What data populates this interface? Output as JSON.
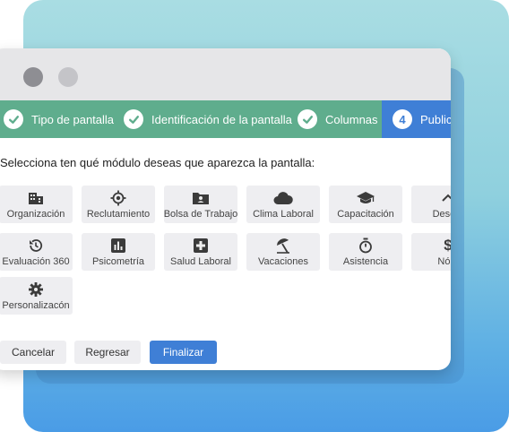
{
  "colors": {
    "step_done": "#5fad8d",
    "step_active": "#3f7fd6",
    "primary_button": "#3f7fd6"
  },
  "stepper": {
    "steps": [
      {
        "label": "Tipo de pantalla",
        "state": "done",
        "icon": "check-icon"
      },
      {
        "label": "Identificación de la pantalla",
        "state": "done",
        "icon": "check-icon"
      },
      {
        "label": "Columnas",
        "state": "done",
        "icon": "check-icon"
      },
      {
        "label": "Publica",
        "state": "active",
        "number": "4"
      }
    ]
  },
  "prompt": "Selecciona ten qué módulo deseas que aparezca la pantalla:",
  "modules": [
    {
      "label": "Organización",
      "icon": "building-icon"
    },
    {
      "label": "Reclutamiento",
      "icon": "target-icon"
    },
    {
      "label": "Bolsa de Trabajo",
      "icon": "folder-user-icon"
    },
    {
      "label": "Clima Laboral",
      "icon": "cloud-icon"
    },
    {
      "label": "Capacitación",
      "icon": "graduation-cap-icon"
    },
    {
      "label": "Desem",
      "icon": "chevron-up-icon"
    },
    {
      "label": "Evaluación 360",
      "icon": "history-icon"
    },
    {
      "label": "Psicometría",
      "icon": "bar-chart-icon"
    },
    {
      "label": "Salud Laboral",
      "icon": "medical-cross-icon"
    },
    {
      "label": "Vacaciones",
      "icon": "umbrella-icon"
    },
    {
      "label": "Asistencia",
      "icon": "stopwatch-icon"
    },
    {
      "label": "Nóm",
      "icon": "dollar-icon"
    },
    {
      "label": "Personalizacón",
      "icon": "gear-icon"
    }
  ],
  "actions": {
    "cancel": "Cancelar",
    "back": "Regresar",
    "finish": "Finalizar"
  }
}
